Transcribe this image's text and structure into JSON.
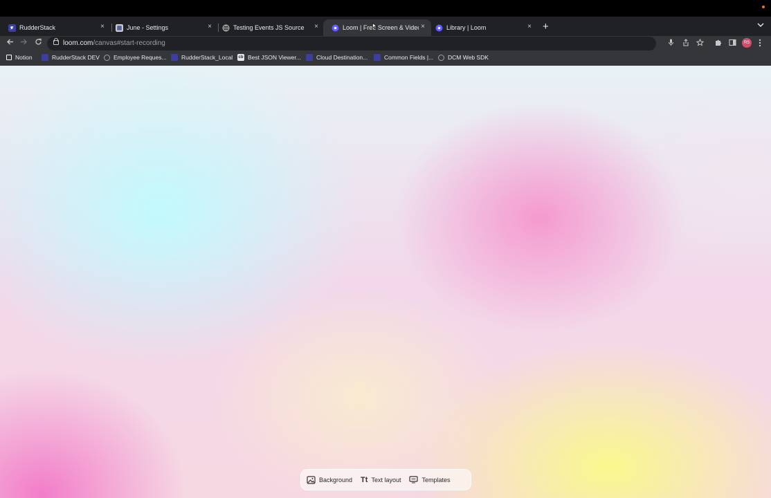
{
  "tabs": [
    {
      "title": "RudderStack",
      "favicon": "rudderstack-favicon",
      "active": false
    },
    {
      "title": "June - Settings",
      "favicon": "june-favicon",
      "active": false
    },
    {
      "title": "Testing Events JS Source",
      "favicon": "globe-favicon",
      "active": false
    },
    {
      "title": "Loom | Free Screen & Video Re",
      "favicon": "loom-favicon",
      "active": true
    },
    {
      "title": "Library | Loom",
      "favicon": "loom-favicon",
      "active": false
    }
  ],
  "toolbar": {
    "url_host": "loom.com",
    "url_path": "/canvas#start-recording",
    "avatar_initials": "RS"
  },
  "bookmarks": [
    {
      "label": "Notion"
    },
    {
      "label": "RudderStack DEV"
    },
    {
      "label": "Employee Reques..."
    },
    {
      "label": "RudderStack_Local"
    },
    {
      "label": "Best JSON Viewer..."
    },
    {
      "label": "Cloud Destination..."
    },
    {
      "label": "Common Fields |..."
    },
    {
      "label": "DCM Web SDK"
    }
  ],
  "canvas_toolbar": {
    "background_label": "Background",
    "text_layout_label": "Text layout",
    "templates_label": "Templates"
  },
  "icons": {
    "close": "×",
    "new_tab": "+",
    "text_layout_glyph": "Tt"
  }
}
